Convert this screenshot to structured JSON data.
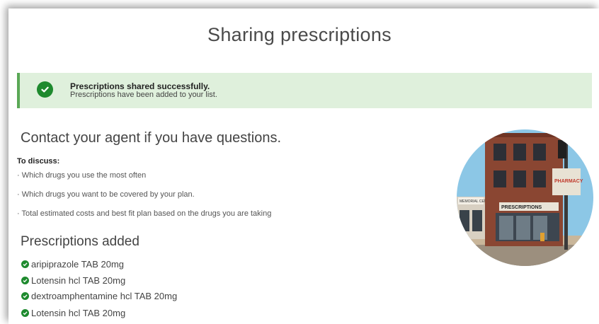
{
  "page": {
    "title": "Sharing prescriptions"
  },
  "alert": {
    "heading": "Prescriptions shared successfully.",
    "message": "Prescriptions have been added to your list.",
    "icon": "check-circle-icon",
    "color": "#1e8a2e",
    "background": "#dff0dc"
  },
  "contact": {
    "heading": "Contact your agent if you have questions.",
    "discuss_label": "To discuss:",
    "items": [
      "· Which drugs you use the most often",
      "· Which drugs you want to be covered by your plan.",
      "· Total estimated costs and best fit plan based on the drugs you are taking"
    ]
  },
  "prescriptions": {
    "heading": "Prescriptions added",
    "items": [
      "aripiprazole TAB 20mg",
      "Lotensin hcl TAB 20mg",
      "dextroamphentamine hcl TAB 20mg",
      "Lotensin hcl TAB 20mg"
    ]
  },
  "image": {
    "signs": [
      "PRESCRIPTIONS",
      "PHARMACY",
      "MEMORIAL CENTER"
    ]
  }
}
